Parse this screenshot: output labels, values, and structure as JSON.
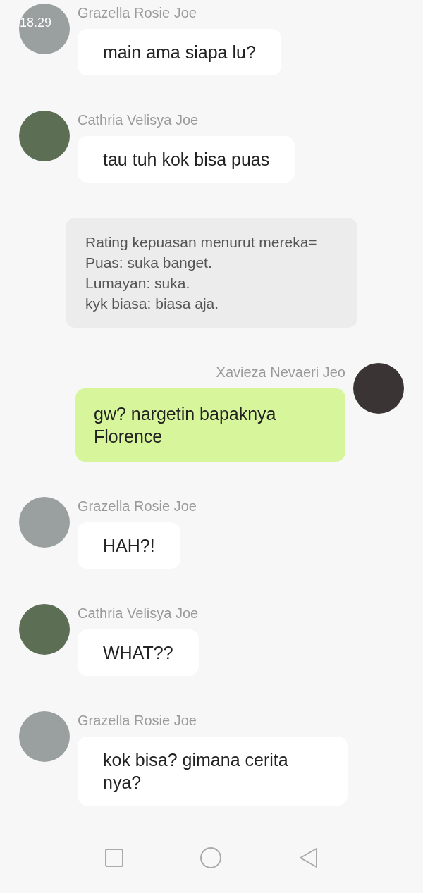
{
  "status_bar": {
    "time": "18.29"
  },
  "messages": [
    {
      "kind": "incoming",
      "sender": "Grazella Rosie Joe",
      "text": "main ama siapa lu?"
    },
    {
      "kind": "incoming",
      "sender": "Cathria Velisya Joe",
      "text": "tau tuh kok bisa puas"
    },
    {
      "kind": "notice",
      "lines": [
        "Rating kepuasan menurut mereka=",
        "Puas: suka banget.",
        "Lumayan: suka.",
        "kyk biasa: biasa aja."
      ]
    },
    {
      "kind": "outgoing",
      "sender": "Xavieza Nevaeri Jeo",
      "text": "gw? nargetin bapaknya Florence"
    },
    {
      "kind": "incoming",
      "sender": "Grazella Rosie Joe",
      "text": "HAH?!"
    },
    {
      "kind": "incoming",
      "sender": "Cathria Velisya Joe",
      "text": "WHAT??"
    },
    {
      "kind": "incoming",
      "sender": "Grazella Rosie Joe",
      "text": "kok bisa? gimana cerita nya?"
    }
  ]
}
